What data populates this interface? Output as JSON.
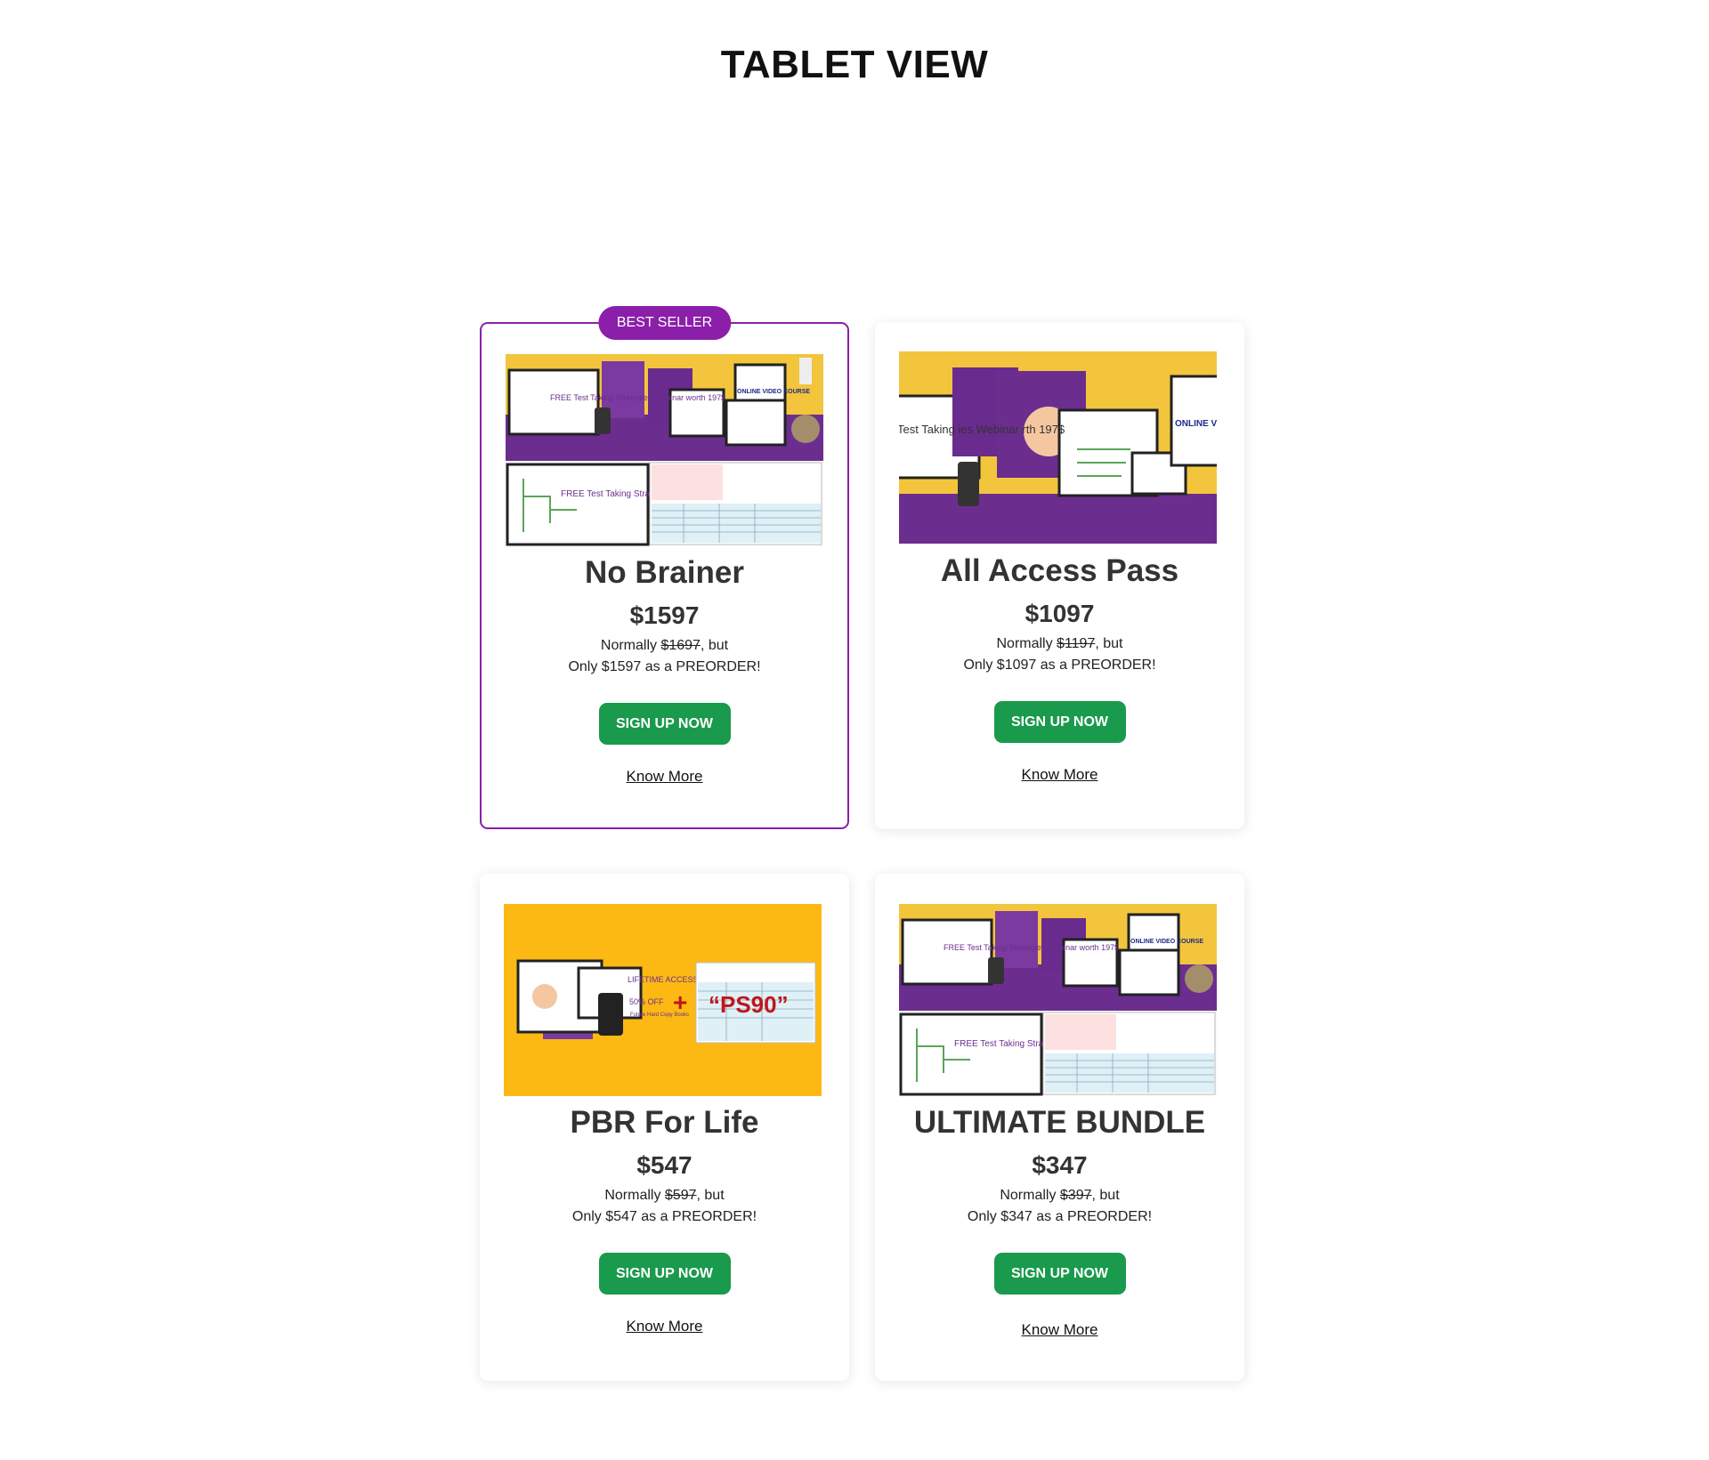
{
  "page": {
    "heading": "TABLET VIEW"
  },
  "colors": {
    "accent": "#8b1fa9",
    "button": "#1a9a4c",
    "thumb_yellow": "#f3c53c",
    "thumb_purple": "#6b2e8f",
    "thumb_orange": "#fdb913"
  },
  "cards": [
    {
      "badge": "BEST SELLER",
      "title": "No Brainer",
      "price": "$1597",
      "normally_prefix": "Normally ",
      "normally_price": "$1697",
      "normally_suffix": ", but",
      "preorder": "Only $1597 as a PREORDER!",
      "cta": "SIGN UP NOW",
      "link": "Know More",
      "image_texts": [
        "FREE Test Taking Strategies Webinar worth 197$",
        "ONLINE VIDEO COURSE"
      ]
    },
    {
      "title": "All Access Pass",
      "price": "$1097",
      "normally_prefix": "Normally ",
      "normally_price": "$1197",
      "normally_suffix": ", but",
      "preorder": "Only $1097 as a PREORDER!",
      "cta": "SIGN UP NOW",
      "link": "Know More",
      "image_texts": [
        "Test Taking ies Webinar rth 197$",
        "ONLINE V COUR"
      ]
    },
    {
      "title": "PBR For Life",
      "price": "$547",
      "normally_prefix": "Normally ",
      "normally_price": "$597",
      "normally_suffix": ", but",
      "preorder": "Only $547 as a PREORDER!",
      "cta": "SIGN UP NOW",
      "link": "Know More",
      "image_texts": [
        "LIFETIME ACCESS",
        "50% OFF",
        "Future Hard Copy Books",
        "+",
        "“PS90”"
      ]
    },
    {
      "title": "ULTIMATE BUNDLE",
      "price": "$347",
      "normally_prefix": "Normally ",
      "normally_price": "$397",
      "normally_suffix": ", but",
      "preorder": "Only $347 as a PREORDER!",
      "cta": "SIGN UP NOW",
      "link": "Know More",
      "image_texts": [
        "FREE Test Taking Strategies Webinar worth 197$",
        "ONLINE VIDEO COURSE"
      ]
    }
  ]
}
